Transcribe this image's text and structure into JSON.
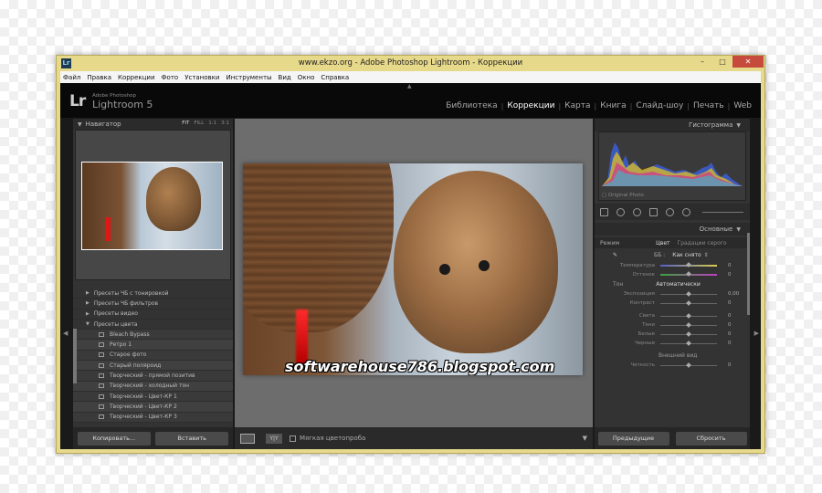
{
  "window": {
    "title": "www.ekzo.org - Adobe Photoshop Lightroom - Коррекции",
    "app_icon": "Lr",
    "controls": {
      "minimize": "–",
      "maximize": "□",
      "close": "✕"
    }
  },
  "menu": [
    "Файл",
    "Правка",
    "Коррекции",
    "Фото",
    "Установки",
    "Инструменты",
    "Вид",
    "Окно",
    "Справка"
  ],
  "identity": {
    "logo": "Lr",
    "brand_small": "Adobe Photoshop",
    "brand": "Lightroom 5"
  },
  "modules": [
    "Библиотека",
    "Коррекции",
    "Карта",
    "Книга",
    "Слайд-шоу",
    "Печать",
    "Web"
  ],
  "active_module": "Коррекции",
  "navigator": {
    "title": "Навигатор",
    "zoom_options": [
      "FIT",
      "FILL",
      "1:1",
      "3:1"
    ],
    "active_zoom": "FIT"
  },
  "presets": {
    "groups": [
      {
        "label": "Пресеты ЧБ с тонировкой"
      },
      {
        "label": "Пресеты ЧБ фильтров"
      },
      {
        "label": "Пресеты видео"
      },
      {
        "label": "Пресеты цвета"
      }
    ],
    "items": [
      "Bleach Bypass",
      "Ретро 1",
      "Старое фото",
      "Старый поляроид",
      "Творческий - прямой позитив",
      "Творческий - холодный тон",
      "Творческий - Цвет-КР 1",
      "Творческий - Цвет-КР 2",
      "Творческий - Цвет-КР 3"
    ]
  },
  "left_buttons": {
    "copy": "Копировать...",
    "paste": "Вставить"
  },
  "toolbar": {
    "yy_label": "Y|Y",
    "soft_proof": "Мягкая цветопроба"
  },
  "watermark": "softwarehouse786.blogspot.com",
  "histogram": {
    "title": "Гистограмма",
    "original_label": "Original Photo"
  },
  "basic": {
    "title": "Основные",
    "mode_label": "Режим",
    "mode_color": "Цвет",
    "mode_gray": "Градации серого",
    "wb_label": "ББ :",
    "wb_value": "Как снято",
    "temperature": {
      "label": "Температура",
      "value": "0"
    },
    "tint": {
      "label": "Оттенок",
      "value": "0"
    },
    "tone_label": "Тон",
    "auto_label": "Автоматически",
    "exposure": {
      "label": "Экспозиция",
      "value": "0,00"
    },
    "contrast": {
      "label": "Контраст",
      "value": "0"
    },
    "highlights": {
      "label": "Света",
      "value": "0"
    },
    "shadows": {
      "label": "Тени",
      "value": "0"
    },
    "whites": {
      "label": "Белые",
      "value": "0"
    },
    "blacks": {
      "label": "Черные",
      "value": "0"
    },
    "presence_label": "Внешний вид",
    "clarity": {
      "label": "Четкость",
      "value": "0"
    }
  },
  "right_buttons": {
    "previous": "Предыдущие",
    "reset": "Сбросить"
  },
  "colors": {
    "window_frame": "#e7d98a",
    "close_button": "#c64b3c",
    "panel": "#333333",
    "center_bg": "#6d6d6d"
  }
}
